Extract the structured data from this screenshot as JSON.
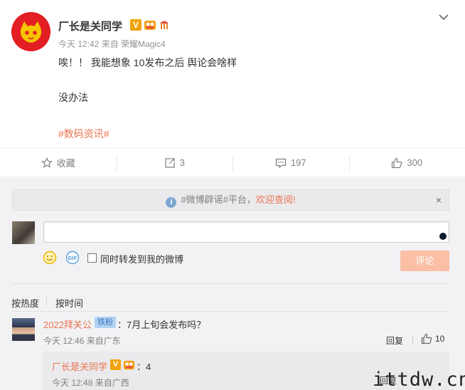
{
  "post": {
    "author": "厂长是关同学",
    "verified_badge": "V",
    "time": "今天 12:42",
    "source_prefix": "来自",
    "source": "荣耀Magic4",
    "line1": "唉！！ 我能想象 10发布之后 舆论会啥样",
    "line2": "没办法",
    "topic": "#数码资讯#",
    "chevron_icon": "chevron-down-icon"
  },
  "actions": {
    "favorite_label": "收藏",
    "repost_count": "3",
    "comment_count": "197",
    "like_count": "300"
  },
  "notice": {
    "before": "#微博辟谣#平台，",
    "link": "欢迎查阅!",
    "close": "×"
  },
  "composer": {
    "repost_label": "同时转发到我的微博",
    "submit_label": "评论"
  },
  "sort": {
    "hot": "按热度",
    "time": "按时间"
  },
  "comment": {
    "user": "2022拜关公",
    "badge": "铁粉",
    "text": "：7月上旬会发布吗？",
    "time": "今天 12:46",
    "source": "来自广东",
    "reply_label": "回复",
    "likes": "10"
  },
  "reply": {
    "user": "厂长是关同学",
    "badge": "V",
    "text": "：4",
    "time": "今天 12:48",
    "source": "来自广西",
    "actions": "回复"
  },
  "watermark": "ittdw.cn",
  "colors": {
    "accent": "#eb7350",
    "badge_gold": "#f0a30a",
    "submit_disabled": "#fbbfa6"
  }
}
